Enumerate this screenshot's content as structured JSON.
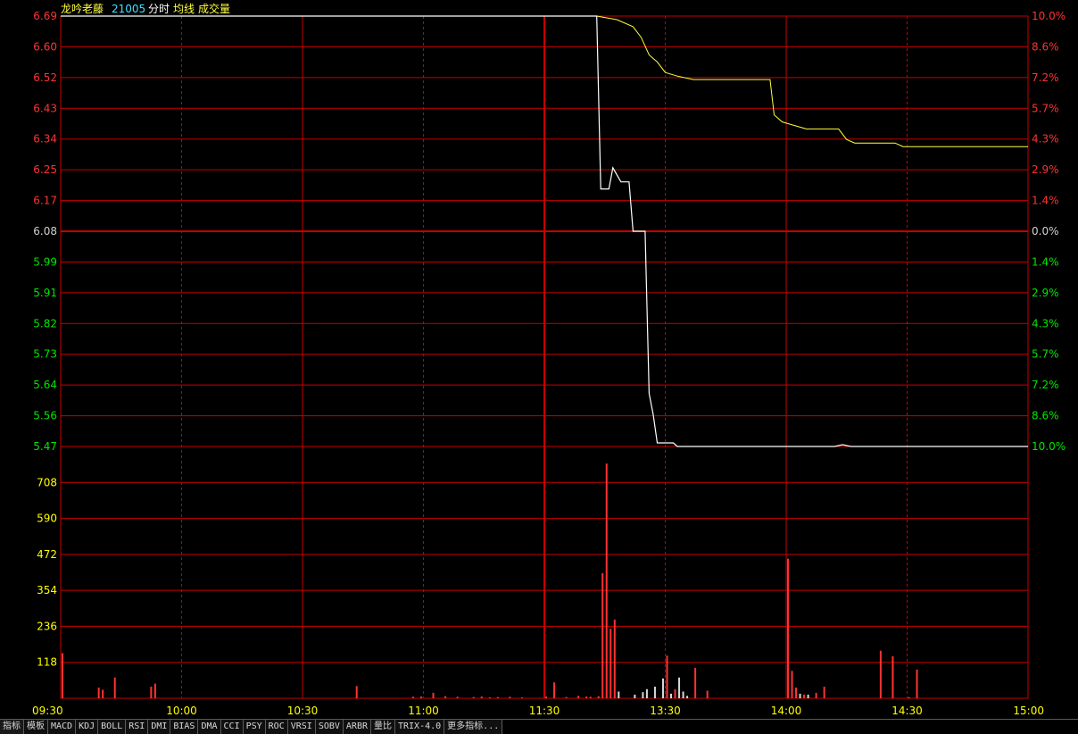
{
  "header": {
    "stock_name": "龙吟老藤",
    "stock_code": "21005",
    "label_mode": "分时",
    "label_avg": "均线",
    "label_volume": "成交量"
  },
  "colors": {
    "grid": "#c80000",
    "up": "#ff3232",
    "down": "#00e600",
    "flat": "#d0d0d0",
    "price_line": "#ffffff",
    "avg_line": "#ffff40",
    "axis_yellow": "#ffff00",
    "volume_white": "#d8d8d8"
  },
  "tabs": [
    "指标",
    "模板",
    "MACD",
    "KDJ",
    "BOLL",
    "RSI",
    "DMI",
    "BIAS",
    "DMA",
    "CCI",
    "PSY",
    "ROC",
    "VRSI",
    "SOBV",
    "ARBR",
    "量比",
    "TRIX-4.0",
    "更多指标..."
  ],
  "chart_data": {
    "type": "line",
    "base_price": 6.08,
    "price_ticks": [
      {
        "price": "6.69",
        "pct": "10.0%",
        "side": "up"
      },
      {
        "price": "6.60",
        "pct": "8.6%",
        "side": "up"
      },
      {
        "price": "6.52",
        "pct": "7.2%",
        "side": "up"
      },
      {
        "price": "6.43",
        "pct": "5.7%",
        "side": "up"
      },
      {
        "price": "6.34",
        "pct": "4.3%",
        "side": "up"
      },
      {
        "price": "6.25",
        "pct": "2.9%",
        "side": "up"
      },
      {
        "price": "6.17",
        "pct": "1.4%",
        "side": "up"
      },
      {
        "price": "6.08",
        "pct": "0.0%",
        "side": "flat"
      },
      {
        "price": "5.99",
        "pct": "1.4%",
        "side": "down"
      },
      {
        "price": "5.91",
        "pct": "2.9%",
        "side": "down"
      },
      {
        "price": "5.82",
        "pct": "4.3%",
        "side": "down"
      },
      {
        "price": "5.73",
        "pct": "5.7%",
        "side": "down"
      },
      {
        "price": "5.64",
        "pct": "7.2%",
        "side": "down"
      },
      {
        "price": "5.56",
        "pct": "8.6%",
        "side": "down"
      },
      {
        "price": "5.47",
        "pct": "10.0%",
        "side": "down"
      }
    ],
    "price_range": [
      5.47,
      6.69
    ],
    "time_labels": [
      "09:30",
      "10:00",
      "10:30",
      "11:00",
      "11:30",
      "13:30",
      "14:00",
      "14:30",
      "15:00"
    ],
    "volume_ticks": [
      "708",
      "590",
      "472",
      "354",
      "236",
      "118"
    ],
    "volume_range": [
      0,
      826
    ],
    "total_minutes": 240,
    "price_series": [
      [
        0,
        6.69
      ],
      [
        133,
        6.69
      ],
      [
        134,
        6.2
      ],
      [
        136,
        6.2
      ],
      [
        137,
        6.26
      ],
      [
        139,
        6.22
      ],
      [
        141,
        6.22
      ],
      [
        142,
        6.08
      ],
      [
        145,
        6.08
      ],
      [
        146,
        5.62
      ],
      [
        147,
        5.56
      ],
      [
        148,
        5.48
      ],
      [
        152,
        5.48
      ],
      [
        153,
        5.47
      ],
      [
        192,
        5.47
      ],
      [
        194,
        5.475
      ],
      [
        196,
        5.47
      ],
      [
        240,
        5.47
      ]
    ],
    "avg_series": [
      [
        0,
        6.69
      ],
      [
        133,
        6.69
      ],
      [
        138,
        6.68
      ],
      [
        142,
        6.66
      ],
      [
        144,
        6.63
      ],
      [
        146,
        6.58
      ],
      [
        148,
        6.56
      ],
      [
        150,
        6.53
      ],
      [
        153,
        6.52
      ],
      [
        157,
        6.51
      ],
      [
        160,
        6.51
      ],
      [
        176,
        6.51
      ],
      [
        177,
        6.41
      ],
      [
        179,
        6.39
      ],
      [
        182,
        6.38
      ],
      [
        185,
        6.37
      ],
      [
        193,
        6.37
      ],
      [
        195,
        6.34
      ],
      [
        197,
        6.33
      ],
      [
        207,
        6.33
      ],
      [
        209,
        6.32
      ],
      [
        240,
        6.32
      ]
    ],
    "volume_series": [
      [
        0,
        148,
        "u"
      ],
      [
        9,
        35,
        "u"
      ],
      [
        10,
        28,
        "u"
      ],
      [
        13,
        68,
        "u"
      ],
      [
        22,
        38,
        "u"
      ],
      [
        23,
        48,
        "u"
      ],
      [
        73,
        40,
        "u"
      ],
      [
        87,
        5,
        "u"
      ],
      [
        89,
        6,
        "u"
      ],
      [
        92,
        18,
        "u"
      ],
      [
        95,
        7,
        "u"
      ],
      [
        98,
        5,
        "u"
      ],
      [
        102,
        4,
        "u"
      ],
      [
        104,
        6,
        "u"
      ],
      [
        106,
        3,
        "u"
      ],
      [
        108,
        4,
        "u"
      ],
      [
        111,
        5,
        "u"
      ],
      [
        114,
        3,
        "u"
      ],
      [
        120,
        6,
        "u"
      ],
      [
        122,
        52,
        "u"
      ],
      [
        125,
        4,
        "u"
      ],
      [
        128,
        8,
        "u"
      ],
      [
        130,
        6,
        "u"
      ],
      [
        131,
        5,
        "u"
      ],
      [
        133,
        7,
        "u"
      ],
      [
        134,
        410,
        "u"
      ],
      [
        135,
        770,
        "u"
      ],
      [
        136,
        228,
        "u"
      ],
      [
        137,
        258,
        "u"
      ],
      [
        138,
        22,
        "d"
      ],
      [
        142,
        12,
        "d"
      ],
      [
        144,
        20,
        "d"
      ],
      [
        145,
        30,
        "d"
      ],
      [
        147,
        38,
        "d"
      ],
      [
        149,
        65,
        "d"
      ],
      [
        150,
        140,
        "u"
      ],
      [
        151,
        15,
        "d"
      ],
      [
        152,
        30,
        "u"
      ],
      [
        153,
        68,
        "d"
      ],
      [
        154,
        22,
        "d"
      ],
      [
        155,
        8,
        "d"
      ],
      [
        157,
        100,
        "u"
      ],
      [
        160,
        25,
        "u"
      ],
      [
        180,
        458,
        "u"
      ],
      [
        181,
        90,
        "u"
      ],
      [
        182,
        35,
        "u"
      ],
      [
        183,
        15,
        "d"
      ],
      [
        184,
        12,
        "u"
      ],
      [
        185,
        12,
        "d"
      ],
      [
        187,
        18,
        "u"
      ],
      [
        189,
        38,
        "u"
      ],
      [
        203,
        156,
        "u"
      ],
      [
        206,
        138,
        "u"
      ],
      [
        210,
        4,
        "u"
      ],
      [
        212,
        94,
        "u"
      ]
    ]
  }
}
